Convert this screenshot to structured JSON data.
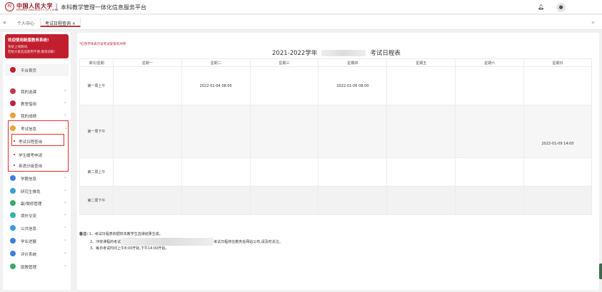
{
  "header": {
    "logo_cn": "中国人民大学",
    "logo_en": "RENMIN UNIVERSITY OF CHINA",
    "title": "本科教学管理一体化信息服务平台",
    "bell_icon": "bell-icon",
    "avatar_icon": "user-avatar-icon"
  },
  "tabs": {
    "nav_left": "«",
    "nav_right": "»",
    "items": [
      "个人中心",
      "考试日程查询 ×"
    ]
  },
  "sidebar": {
    "notice": {
      "title": "欢迎使用新版教务系统!",
      "line1": "系统上线期间,",
      "line2": "若给大家造成使用不便,敬请谅解!"
    },
    "home": "平台首页",
    "items": [
      {
        "label": "我的选课",
        "icon_color": "#c2394a"
      },
      {
        "label": "教室借用",
        "icon_color": "#b8263a"
      },
      {
        "label": "我的成绩",
        "icon_color": "#e6a33a"
      },
      {
        "label": "考试信息",
        "icon_color": "#e6a33a"
      },
      {
        "label": "学籍信息",
        "icon_color": "#3f7fd8"
      },
      {
        "label": "研究生推免",
        "icon_color": "#3a9bd8"
      },
      {
        "label": "副/微修管理",
        "icon_color": "#3aa86a"
      },
      {
        "label": "境外交流",
        "icon_color": "#2fb5a6"
      },
      {
        "label": "公共信息",
        "icon_color": "#3a9bd8"
      },
      {
        "label": "学业进展",
        "icon_color": "#3f7fd8"
      },
      {
        "label": "评价系统",
        "icon_color": "#3f7fd8"
      },
      {
        "label": "助教管理",
        "icon_color": "#3aa86a"
      }
    ],
    "sub_items": [
      "考试日程查询",
      "学生缓考申请",
      "英语分级查询"
    ]
  },
  "main": {
    "red_tip": "*红色字体表示该考试安排有冲突",
    "title_left": "2021-2022学年",
    "title_right": "考试日程表",
    "headers": [
      "课次/星期",
      "星期一",
      "星期二",
      "星期三",
      "星期四",
      "星期五",
      "星期六",
      "星期日"
    ],
    "rows": [
      {
        "label": "第一周上午",
        "cells": [
          "",
          "2022-01-04 08:00",
          "",
          "2022-01-06 08:00",
          "",
          "",
          ""
        ]
      },
      {
        "label": "第一周下午",
        "cells": [
          "",
          "",
          "",
          "",
          "",
          "",
          "2022-01-09 14:00"
        ]
      },
      {
        "label": "第二周上午",
        "cells": [
          "",
          "",
          "",
          "",
          "",
          "",
          ""
        ]
      },
      {
        "label": "第二周下午",
        "cells": [
          "",
          "",
          "",
          "",
          "",
          "",
          ""
        ]
      }
    ],
    "notes": {
      "label": "备注:",
      "n1": "1、考试日程表依据校本教学生选课结果生成。",
      "n2a": "2、冲突课程的考试",
      "n2b": "考试日程将在教务处网站公布,请及时关注。",
      "n3": "3、每日考试时间上午8:00开始,下午14:00开始。"
    }
  }
}
